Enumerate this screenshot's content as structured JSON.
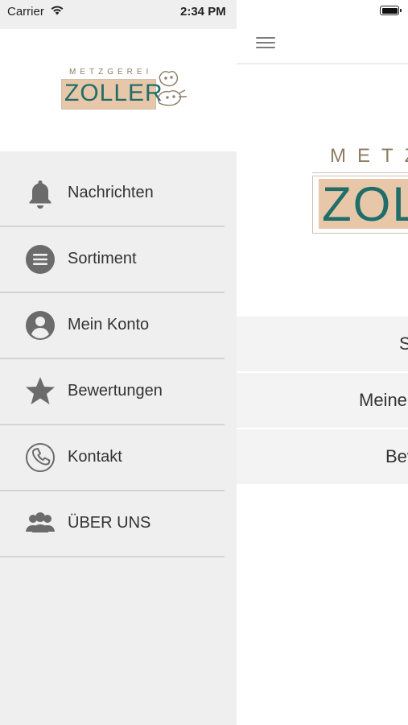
{
  "status_bar": {
    "carrier": "Carrier",
    "time": "2:34 PM"
  },
  "logo": {
    "small_top": "METZGEREI",
    "small_name": "ZOLLER",
    "big_top": "METZ",
    "big_name": "ZOL"
  },
  "drawer_menu": [
    {
      "label": "Nachrichten",
      "icon": "bell-icon"
    },
    {
      "label": "Sortiment",
      "icon": "list-circle-icon"
    },
    {
      "label": "Mein Konto",
      "icon": "user-circle-icon"
    },
    {
      "label": "Bewertungen",
      "icon": "star-icon"
    },
    {
      "label": "Kontakt",
      "icon": "phone-icon"
    },
    {
      "label": "ÜBER UNS",
      "icon": "group-icon"
    }
  ],
  "main_list": [
    {
      "label": "S"
    },
    {
      "label": "Meine"
    },
    {
      "label": "Bev"
    }
  ],
  "colors": {
    "accent_teal": "#1f6e6a",
    "logo_bg": "#e8c7a8",
    "icon_gray": "#6b6b6b",
    "drawer_bg": "#efefef"
  }
}
